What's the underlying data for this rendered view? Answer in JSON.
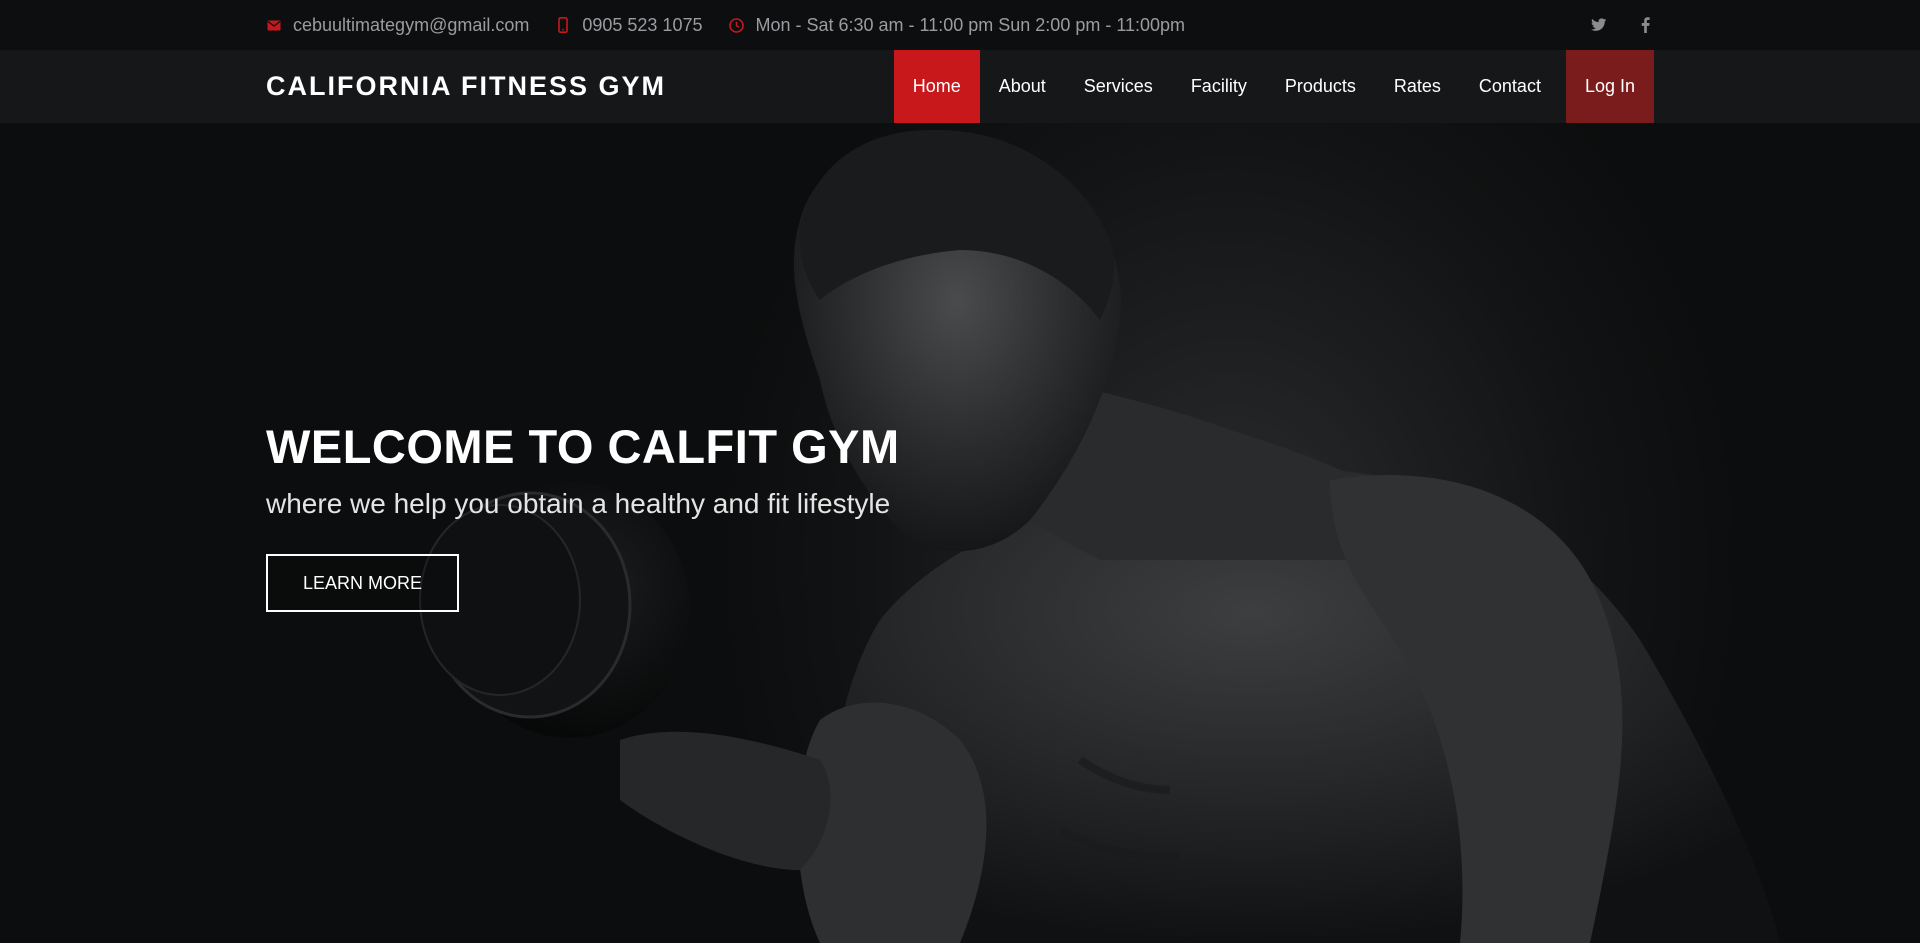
{
  "topbar": {
    "email": "cebuultimategym@gmail.com",
    "phone": "0905 523 1075",
    "hours": "Mon - Sat 6:30 am - 11:00 pm Sun 2:00 pm - 11:00pm",
    "icons": {
      "email": "envelope-icon",
      "phone": "mobile-phone-icon",
      "hours": "clock-icon",
      "twitter": "twitter-icon",
      "facebook": "facebook-icon"
    }
  },
  "navbar": {
    "brand": "CALIFORNIA FITNESS GYM",
    "items": [
      {
        "label": "Home",
        "active": true
      },
      {
        "label": "About"
      },
      {
        "label": "Services"
      },
      {
        "label": "Facility"
      },
      {
        "label": "Products"
      },
      {
        "label": "Rates"
      },
      {
        "label": "Contact"
      }
    ],
    "login": "Log In"
  },
  "hero": {
    "title": "WELCOME TO CALFIT GYM",
    "subtitle": "where we help you obtain a healthy and fit lifestyle",
    "button": "LEARN MORE"
  },
  "colors": {
    "accent": "#c8181c",
    "login_bg": "#7a1c1c",
    "background": "#0b0c0d",
    "text": "#ffffff"
  }
}
